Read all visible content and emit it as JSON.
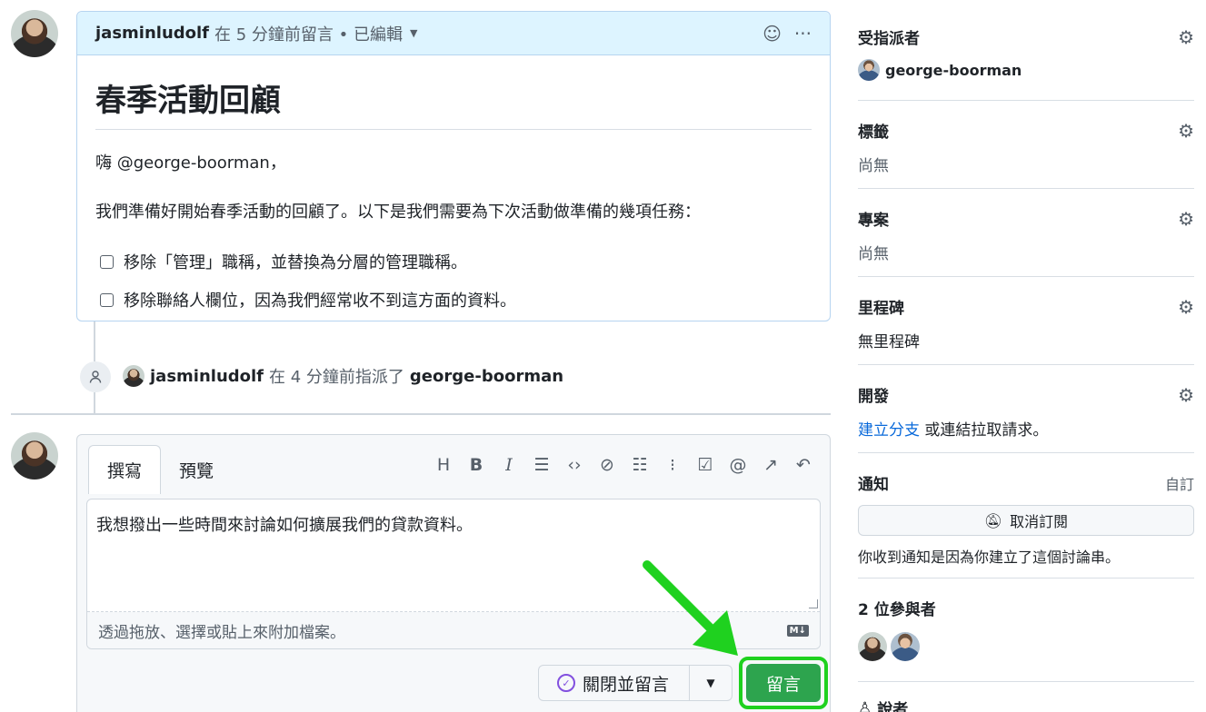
{
  "comment": {
    "author": "jasminludolf",
    "meta": "在 5 分鐘前留言 • 已編輯",
    "title": "春季活動回顧",
    "greeting": "嗨 @george-boorman，",
    "intro": "我們準備好開始春季活動的回顧了。以下是我們需要為下次活動做準備的幾項任務：",
    "tasks": [
      "移除「管理」職稱，並替換為分層的管理職稱。",
      "移除聯絡人欄位，因為我們經常收不到這方面的資料。"
    ]
  },
  "event": {
    "actor": "jasminludolf",
    "action": "在 4 分鐘前指派了",
    "target": "george-boorman"
  },
  "composer": {
    "tab_write": "撰寫",
    "tab_preview": "預覽",
    "toolbar_icons": [
      "heading-icon",
      "bold-icon",
      "italic-icon",
      "quote-icon",
      "code-icon",
      "link-icon",
      "bullet-list-icon",
      "numbered-list-icon",
      "task-list-icon",
      "mention-icon",
      "reference-icon",
      "undo-icon"
    ],
    "text": "我想撥出一些時間來討論如何擴展我們的貸款資料。",
    "attach_hint": "透過拖放、選擇或貼上來附加檔案。",
    "md_badge": "M↓",
    "close_label": "關閉並留言",
    "submit_label": "留言",
    "highlight_color": "#1fd11f"
  },
  "sidebar": {
    "assignees": {
      "label": "受指派者",
      "value": "george-boorman"
    },
    "labels": {
      "label": "標籤",
      "value": "尚無"
    },
    "projects": {
      "label": "專案",
      "value": "尚無"
    },
    "milestone": {
      "label": "里程碑",
      "value": "無里程碑"
    },
    "development": {
      "label": "開發",
      "link": "建立分支",
      "rest": "或連結拉取請求。"
    },
    "notifications": {
      "label": "通知",
      "custom": "自訂",
      "button": "取消訂閱",
      "note": "你收到通知是因為你建立了這個討論串。"
    },
    "participants": {
      "label": "2 位參與者"
    },
    "more": {
      "label": "說者"
    }
  },
  "colors": {
    "accent_blue": "#0969da",
    "green_button": "#2da44e",
    "header_bg": "#ddf4ff"
  }
}
